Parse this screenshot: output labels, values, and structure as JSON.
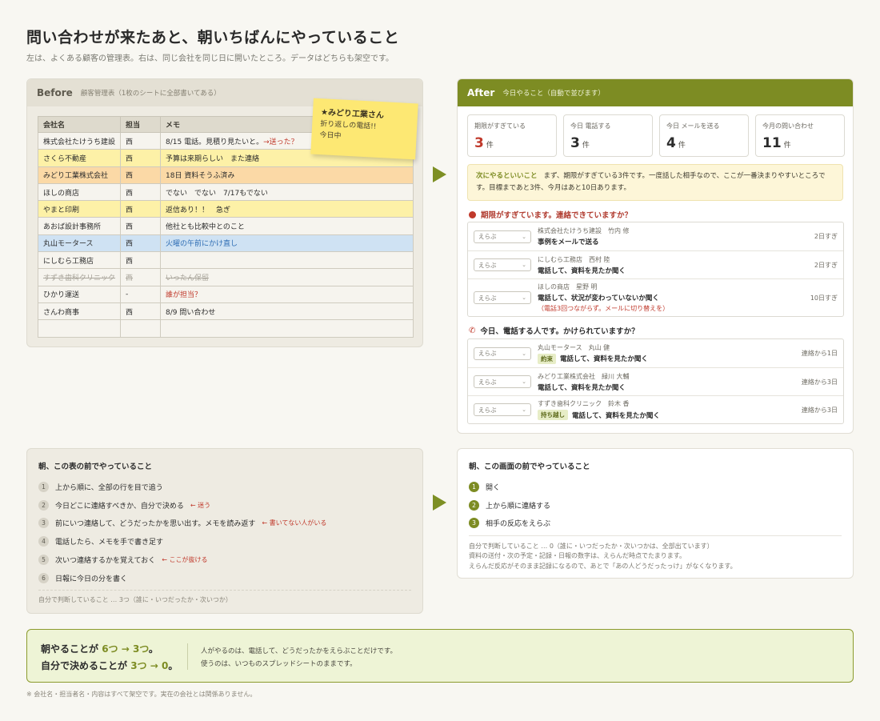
{
  "page": {
    "title": "問い合わせが来たあと、朝いちばんにやっていること",
    "subtitle": "左は、よくある顧客の管理表。右は、同じ会社を同じ日に開いたところ。データはどちらも架空です。",
    "footnote": "※ 会社名・担当者名・内容はすべて架空です。実在の会社とは関係ありません。"
  },
  "before": {
    "title": "Before",
    "subtitle": "顧客管理表（1枚のシートに全部書いてある）",
    "headers": [
      "会社名",
      "担当",
      "メモ"
    ],
    "rows": [
      {
        "company": "株式会社たけうち建設",
        "owner": "西",
        "memo": "8/15 電話。見積り見たいと。",
        "memo_note": "→送った？"
      },
      {
        "company": "さくら不動産",
        "owner": "西",
        "memo": "予算は来期らしい　また連絡",
        "memo_note": ""
      },
      {
        "company": "みどり工業株式会社",
        "owner": "西",
        "memo": "18日 資料そうふ済み",
        "memo_note": ""
      },
      {
        "company": "ほしの商店",
        "owner": "西",
        "memo": "でない　でない　7/17もでない",
        "memo_note": ""
      },
      {
        "company": "やまと印刷",
        "owner": "西",
        "memo": "返信あり！！　急ぎ",
        "memo_note": ""
      },
      {
        "company": "あおば設計事務所",
        "owner": "西",
        "memo": "他社とも比較中とのこと",
        "memo_note": ""
      },
      {
        "company": "丸山モータース",
        "owner": "西",
        "memo": "火曜の午前にかけ直し",
        "memo_note": ""
      },
      {
        "company": "にしむら工務店",
        "owner": "西",
        "memo": "",
        "memo_note": ""
      },
      {
        "company": "すずき歯科クリニック",
        "owner": "西",
        "memo": "いったん保留",
        "memo_note": ""
      },
      {
        "company": "ひかり運送",
        "owner": "-",
        "memo": "誰が担当？",
        "memo_note": ""
      },
      {
        "company": "さんわ商事",
        "owner": "西",
        "memo": "8/9 問い合わせ",
        "memo_note": ""
      },
      {
        "company": "",
        "owner": "",
        "memo": "",
        "memo_note": ""
      }
    ],
    "sticky": {
      "line1": "★みどり工業さん",
      "line2": "折り返しの電話!!",
      "line3": "今日中"
    }
  },
  "after": {
    "title": "After",
    "subtitle": "今日やること（自動で並びます）",
    "cards": [
      {
        "label": "期限がすぎている",
        "value": "3",
        "unit": "件"
      },
      {
        "label": "今日 電話する",
        "value": "3",
        "unit": "件"
      },
      {
        "label": "今日 メールを送る",
        "value": "4",
        "unit": "件"
      },
      {
        "label": "今月の問い合わせ",
        "value": "11",
        "unit": "件"
      }
    ],
    "notice": {
      "key": "次にやるといいこと",
      "text": "まず、期限がすぎている3件です。一度話した相手なので、ここが一番決まりやすいところです。目標まであと3件、今月はあと10日あります。"
    },
    "overdue": {
      "heading": "期限がすぎています。連絡できていますか？",
      "items": [
        {
          "select": "えらぶ",
          "company": "株式会社たけうち建設　竹内 修",
          "action": "事例をメールで送る",
          "tag": "",
          "warn": "",
          "due": "2日すぎ"
        },
        {
          "select": "えらぶ",
          "company": "にしむら工務店　西村 陸",
          "action": "電話して、資料を見たか聞く",
          "tag": "",
          "warn": "",
          "due": "2日すぎ"
        },
        {
          "select": "えらぶ",
          "company": "ほしの商店　星野 明",
          "action": "電話して、状況が変わっていないか聞く",
          "tag": "",
          "warn": "（電話3回つながらず。メールに切り替えを）",
          "due": "10日すぎ"
        }
      ]
    },
    "today_calls": {
      "heading": "今日、電話する人です。かけられていますか？",
      "items": [
        {
          "select": "えらぶ",
          "company": "丸山モータース　丸山 健",
          "action": "電話して、資料を見たか聞く",
          "tag": "約束",
          "due": "連絡から1日"
        },
        {
          "select": "えらぶ",
          "company": "みどり工業株式会社　緑川 大輔",
          "action": "電話して、資料を見たか聞く",
          "tag": "",
          "due": "連絡から3日"
        },
        {
          "select": "えらぶ",
          "company": "すずき歯科クリニック　鈴木 香",
          "action": "電話して、資料を見たか聞く",
          "tag": "持ち越し",
          "due": "連絡から3日"
        }
      ]
    }
  },
  "bottom_left": {
    "heading": "朝、この表の前でやっていること",
    "steps": [
      {
        "n": "1",
        "text": "上から順に、全部の行を目で追う",
        "note": ""
      },
      {
        "n": "2",
        "text": "今日どこに連絡すべきか、自分で決める",
        "note": "← 迷う"
      },
      {
        "n": "3",
        "text": "前にいつ連絡して、どうだったかを思い出す。メモを読み返す",
        "note": "← 書いてない人がいる"
      },
      {
        "n": "4",
        "text": "電話したら、メモを手で書き足す",
        "note": ""
      },
      {
        "n": "5",
        "text": "次いつ連絡するかを覚えておく",
        "note": "← ここが抜ける"
      },
      {
        "n": "6",
        "text": "日報に今日の分を書く",
        "note": ""
      }
    ],
    "foot": "自分で判断していること … 3つ（誰に・いつだったか・次いつか）"
  },
  "bottom_right": {
    "heading": "朝、この画面の前でやっていること",
    "steps": [
      {
        "n": "1",
        "text": "開く"
      },
      {
        "n": "2",
        "text": "上から順に連絡する"
      },
      {
        "n": "3",
        "text": "相手の反応をえらぶ"
      }
    ],
    "foot1": "自分で判断していること … 0（誰に・いつだったか・次いつかは、全部出ています）",
    "foot2": "資料の送付・次の予定・記録・日報の数字は、えらんだ時点でたまります。",
    "foot3": "えらんだ反応がそのまま記録になるので、あとで「あの人どうだったっけ」がなくなります。"
  },
  "summary": {
    "l1a": "朝やることが ",
    "l1b": "6つ → 3つ",
    "l1c": "。",
    "l2a": "自分で決めることが ",
    "l2b": "3つ → 0",
    "l2c": "。",
    "r1": "人がやるのは、電話して、どうだったかをえらぶことだけです。",
    "r2": "使うのは、いつものスプレッドシートのままです。"
  },
  "colors": {
    "accent": "#7d8c23",
    "alert": "#c0392b",
    "highlight_yellow": "#fdf1a7",
    "highlight_orange": "#fbd9a6",
    "highlight_blue": "#cfe2f3"
  }
}
